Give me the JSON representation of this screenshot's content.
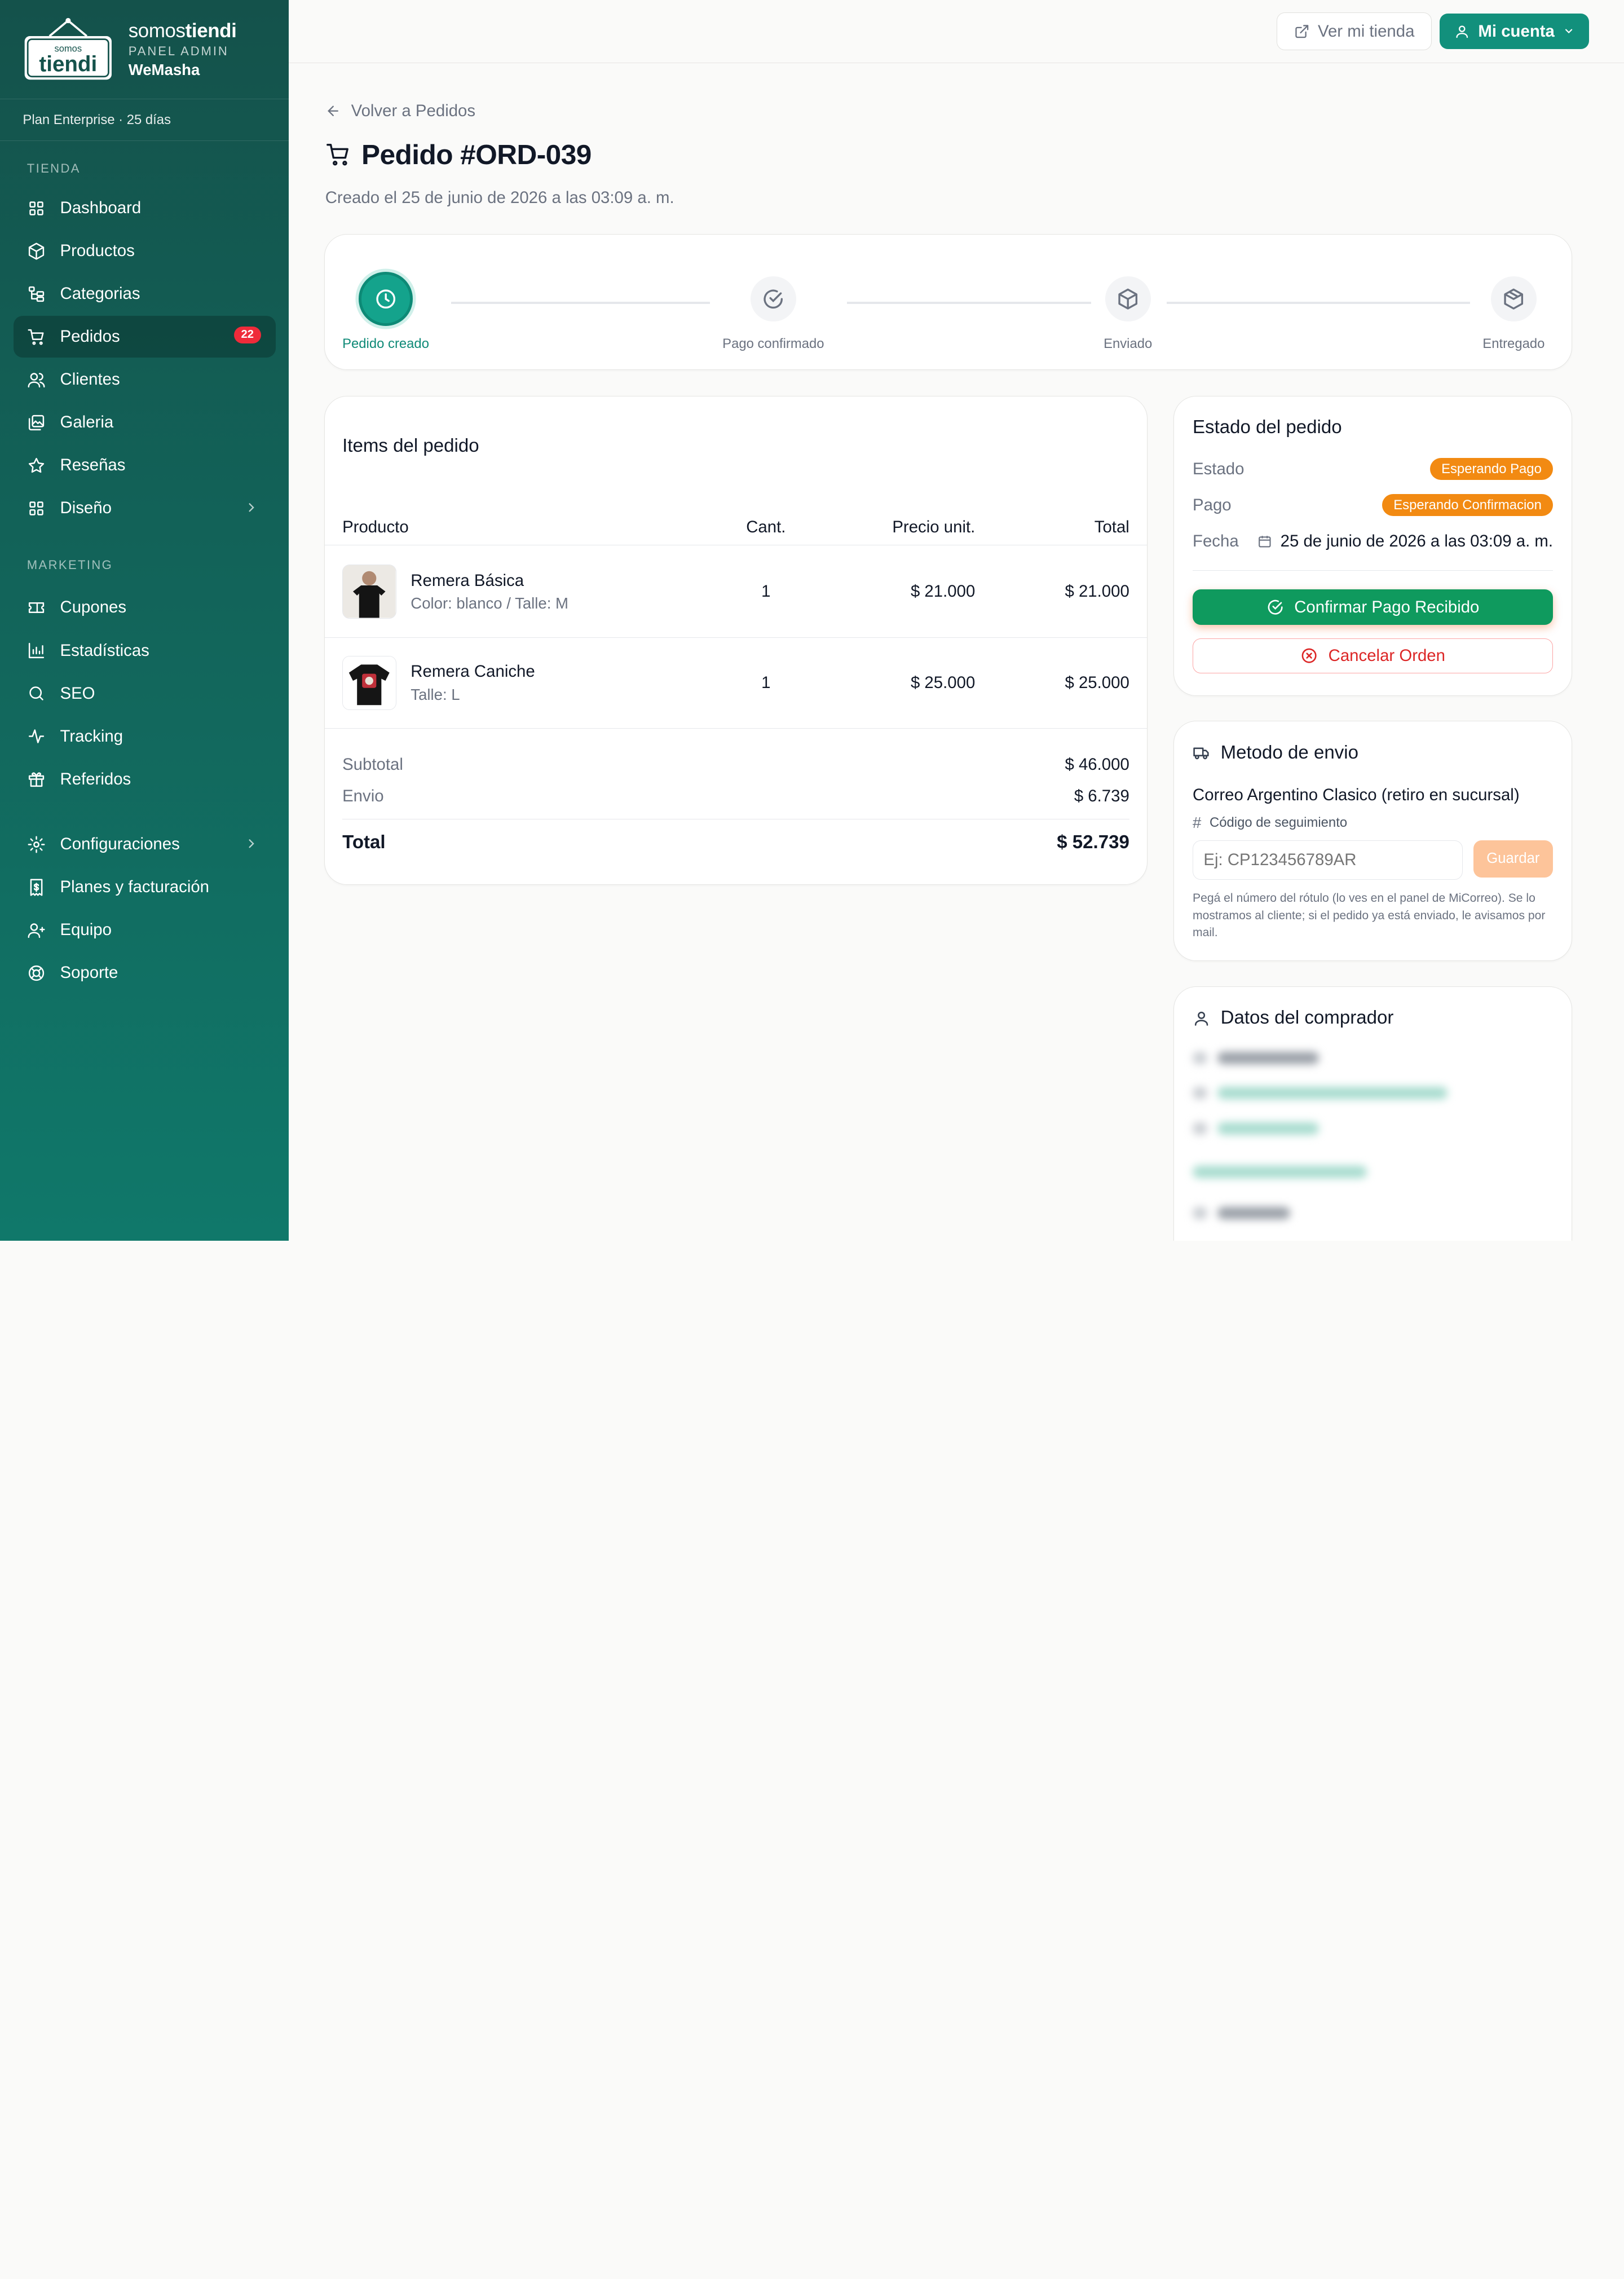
{
  "brand": {
    "logo_text_small": "somos",
    "logo_text_big": "tiendi",
    "title_light": "somos",
    "title_bold": "tiendi",
    "subtitle": "PANEL ADMIN",
    "store": "WeMasha"
  },
  "plan": "Plan Enterprise · 25 días",
  "sidebar": {
    "section_tienda": "TIENDA",
    "section_marketing": "MARKETING",
    "tienda_items": [
      {
        "label": "Dashboard",
        "icon": "grid-icon"
      },
      {
        "label": "Productos",
        "icon": "box-icon"
      },
      {
        "label": "Categorias",
        "icon": "hierarchy-icon"
      },
      {
        "label": "Pedidos",
        "icon": "cart-icon",
        "badge": "22",
        "active": true
      },
      {
        "label": "Clientes",
        "icon": "users-icon"
      },
      {
        "label": "Galeria",
        "icon": "gallery-icon"
      },
      {
        "label": "Reseñas",
        "icon": "star-icon"
      },
      {
        "label": "Diseño",
        "icon": "grid-icon",
        "expandable": true
      }
    ],
    "marketing_items": [
      {
        "label": "Cupones",
        "icon": "ticket-icon"
      },
      {
        "label": "Estadísticas",
        "icon": "bar-chart-icon"
      },
      {
        "label": "SEO",
        "icon": "search-icon"
      },
      {
        "label": "Tracking",
        "icon": "activity-icon"
      },
      {
        "label": "Referidos",
        "icon": "gift-icon"
      }
    ],
    "bottom_items": [
      {
        "label": "Configuraciones",
        "icon": "gear-icon",
        "expandable": true
      },
      {
        "label": "Planes y facturación",
        "icon": "receipt-icon"
      },
      {
        "label": "Equipo",
        "icon": "team-icon"
      },
      {
        "label": "Soporte",
        "icon": "lifebuoy-icon"
      }
    ]
  },
  "topbar": {
    "ver_tienda": "Ver mi tienda",
    "mi_cuenta": "Mi cuenta"
  },
  "order": {
    "back_label": "Volver a Pedidos",
    "title": "Pedido #ORD-039",
    "created": "Creado el 25 de junio de 2026 a las 03:09 a. m."
  },
  "steps": [
    {
      "label": "Pedido creado",
      "icon": "clock-icon",
      "done": true
    },
    {
      "label": "Pago confirmado",
      "icon": "check-circle-icon",
      "done": false
    },
    {
      "label": "Enviado",
      "icon": "package-icon",
      "done": false
    },
    {
      "label": "Entregado",
      "icon": "package-check-icon",
      "done": false
    }
  ],
  "items_card": {
    "title": "Items del pedido",
    "columns": [
      "Producto",
      "Cant.",
      "Precio unit.",
      "Total"
    ],
    "rows": [
      {
        "name": "Remera Básica",
        "variant": "Color: blanco / Talle: M",
        "qty": "1",
        "unit": "$ 21.000",
        "total": "$ 21.000"
      },
      {
        "name": "Remera Caniche",
        "variant": "Talle: L",
        "qty": "1",
        "unit": "$ 25.000",
        "total": "$ 25.000"
      }
    ],
    "subtotal_label": "Subtotal",
    "subtotal": "$ 46.000",
    "envio_label": "Envio",
    "envio": "$ 6.739",
    "total_label": "Total",
    "total": "$ 52.739"
  },
  "estado_card": {
    "title": "Estado del pedido",
    "estado_label": "Estado",
    "estado_value": "Esperando Pago",
    "pago_label": "Pago",
    "pago_value": "Esperando Confirmacion",
    "fecha_label": "Fecha",
    "fecha_value": "25 de junio de 2026 a las 03:09 a. m.",
    "confirm_button": "Confirmar Pago Recibido",
    "cancel_button": "Cancelar Orden",
    "pill_color": "#f28a12"
  },
  "envio_card": {
    "title": "Metodo de envio",
    "method": "Correo Argentino Clasico (retiro en sucursal)",
    "tracking_label": "Código de seguimiento",
    "tracking_placeholder": "Ej: CP123456789AR",
    "save_button": "Guardar",
    "hint": "Pegá el número del rótulo (lo ves en el panel de MiCorreo). Se lo mostramos al cliente; si el pedido ya está enviado, le avisamos por mail."
  },
  "comprador_card": {
    "title": "Datos del comprador"
  },
  "colors": {
    "sidebar_top": "#14524b",
    "sidebar_bottom": "#10786a",
    "accent": "#12907c",
    "confirm_green": "#0f9a5e",
    "danger": "#dc2626",
    "badge_red": "#ef2b3a"
  }
}
